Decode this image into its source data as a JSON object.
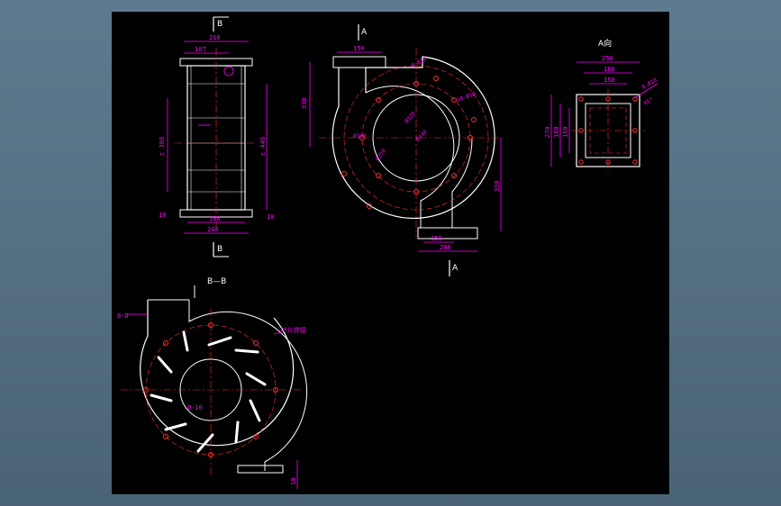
{
  "drawing": {
    "front_view": {
      "section_marker": "B",
      "dims": {
        "top_overall": "210",
        "top_inner": "107",
        "height_left": "c 380",
        "height_right": "c 440",
        "bottom_inner": "180",
        "bottom_overall": "240",
        "side_left": "10",
        "side_right": "10"
      }
    },
    "volute_view": {
      "section_marker": "A",
      "dims": {
        "top_flange": "150",
        "left_height": "330",
        "right_height": "330",
        "bottom_inner": "150",
        "bottom_overall": "280",
        "circle_a": "Ø380",
        "circle_b": "Ø250",
        "circle_c": "Ø320",
        "circle_d": "Ø440",
        "holes_top": "8-Ø10",
        "holes_right": "10-Ø10"
      }
    },
    "flange_view": {
      "title": "A向",
      "dims": {
        "top_overall": "250",
        "top_mid": "180",
        "top_inner": "150",
        "left_overall": "270",
        "left_mid": "180",
        "left_inner": "150",
        "holes": "8-Ø10",
        "angle": "45°"
      }
    },
    "section_view": {
      "title": "B—B",
      "dims": {
        "blade_left": "8-Ø",
        "inner": "Ø-10",
        "note": "叶片焊接",
        "bottom": "10"
      }
    }
  }
}
